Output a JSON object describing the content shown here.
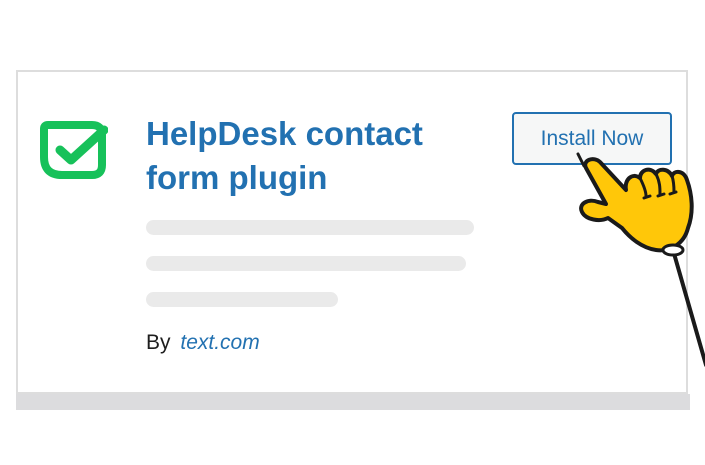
{
  "plugin": {
    "title": "HelpDesk contact form plugin",
    "install_label": "Install Now",
    "by_label": "By",
    "author": "text.com"
  },
  "colors": {
    "brand_green": "#17c15a",
    "link_blue": "#2271b1",
    "hand_yellow": "#ffc709"
  },
  "icons": {
    "plugin": "checkbox-checked-icon",
    "cursor": "pointing-hand-icon"
  }
}
